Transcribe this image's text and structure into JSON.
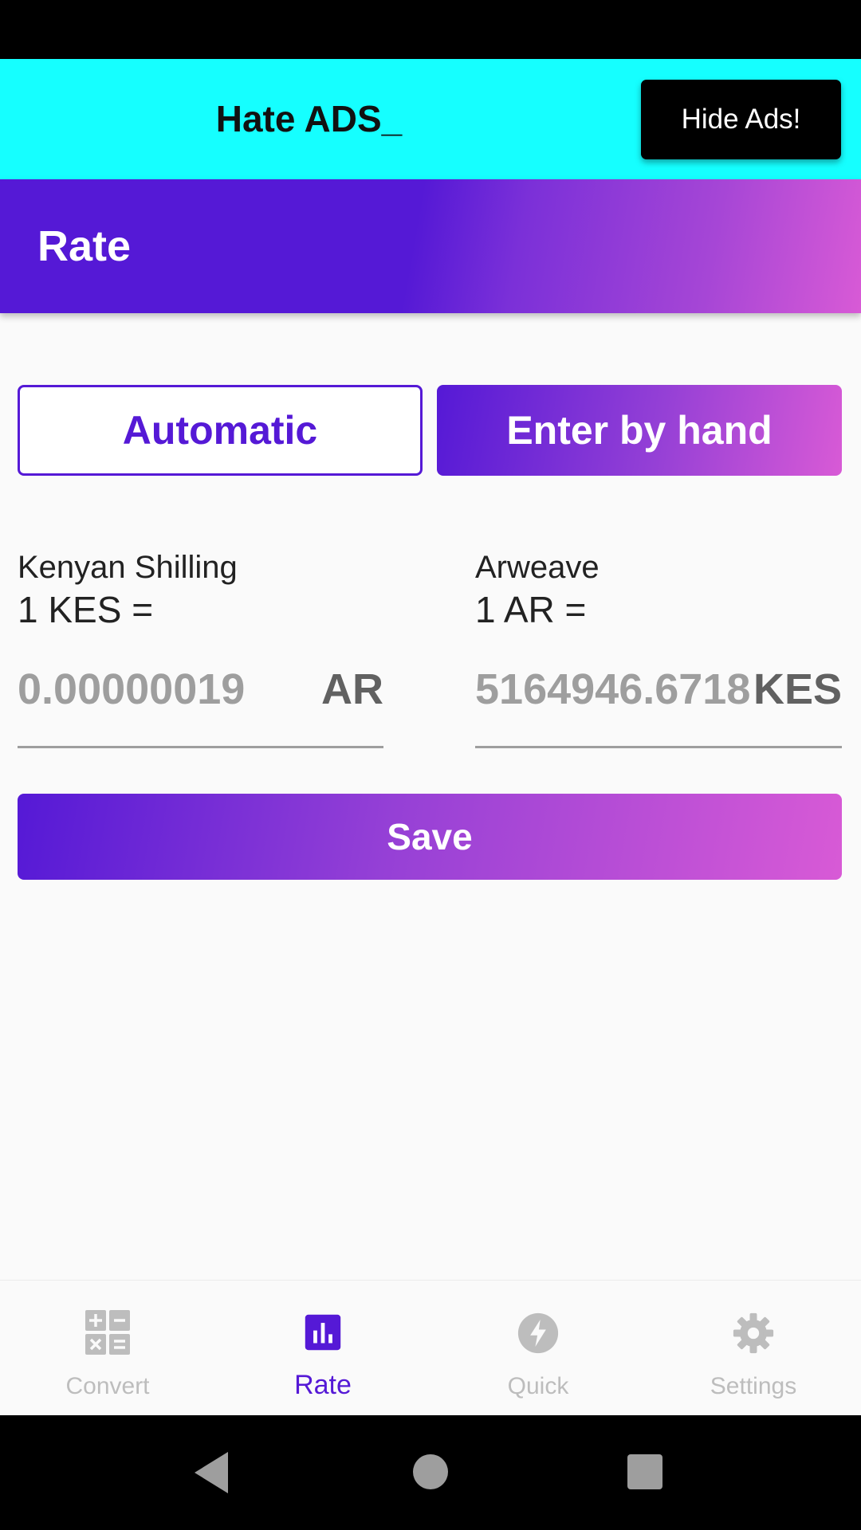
{
  "ad_banner": {
    "title": "Hate ADS_",
    "hide_button": "Hide Ads!"
  },
  "app_bar": {
    "title": "Rate"
  },
  "mode_toggle": {
    "automatic_label": "Automatic",
    "manual_label": "Enter by hand",
    "selected": "Enter by hand"
  },
  "rate_left": {
    "currency_name": "Kenyan Shilling",
    "equation": "1 KES =",
    "value": "0.00000019",
    "unit": "AR"
  },
  "rate_right": {
    "currency_name": "Arweave",
    "equation": "1 AR =",
    "value": "5164946.67184",
    "unit": "KES"
  },
  "save_button": "Save",
  "bottom_nav": {
    "items": [
      {
        "label": "Convert",
        "icon": "calculator-icon",
        "active": false
      },
      {
        "label": "Rate",
        "icon": "bar-chart-icon",
        "active": true
      },
      {
        "label": "Quick",
        "icon": "lightning-icon",
        "active": false
      },
      {
        "label": "Settings",
        "icon": "gear-icon",
        "active": false
      }
    ]
  },
  "colors": {
    "accent": "#5519d6",
    "gradient_end": "#d85ad6",
    "ad_banner_bg": "#15ffff"
  }
}
